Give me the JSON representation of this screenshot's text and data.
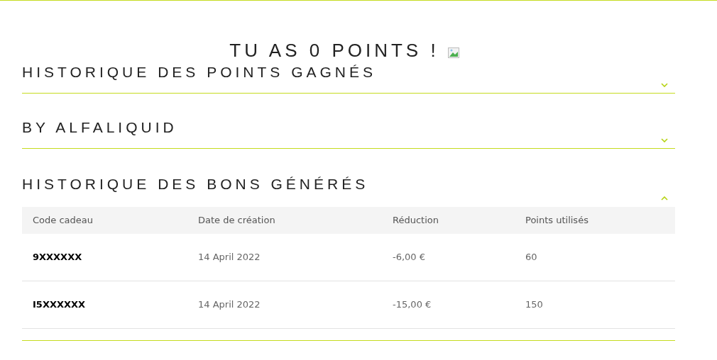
{
  "title": "TU AS 0 POINTS !",
  "sections": [
    {
      "title": "HISTORIQUE DES POINTS GAGNÉS",
      "expanded": false
    },
    {
      "title": "BY ALFALIQUID",
      "expanded": false
    },
    {
      "title": "HISTORIQUE DES BONS GÉNÉRÉS",
      "expanded": true,
      "table": {
        "columns": [
          "Code cadeau",
          "Date de création",
          "Réduction",
          "Points utilisés"
        ],
        "rows": [
          [
            "9XXXXXX",
            "14 April 2022",
            "-6,00 €",
            "60"
          ],
          [
            "I5XXXXXX",
            "14 April 2022",
            "-15,00 €",
            "150"
          ]
        ]
      }
    }
  ]
}
